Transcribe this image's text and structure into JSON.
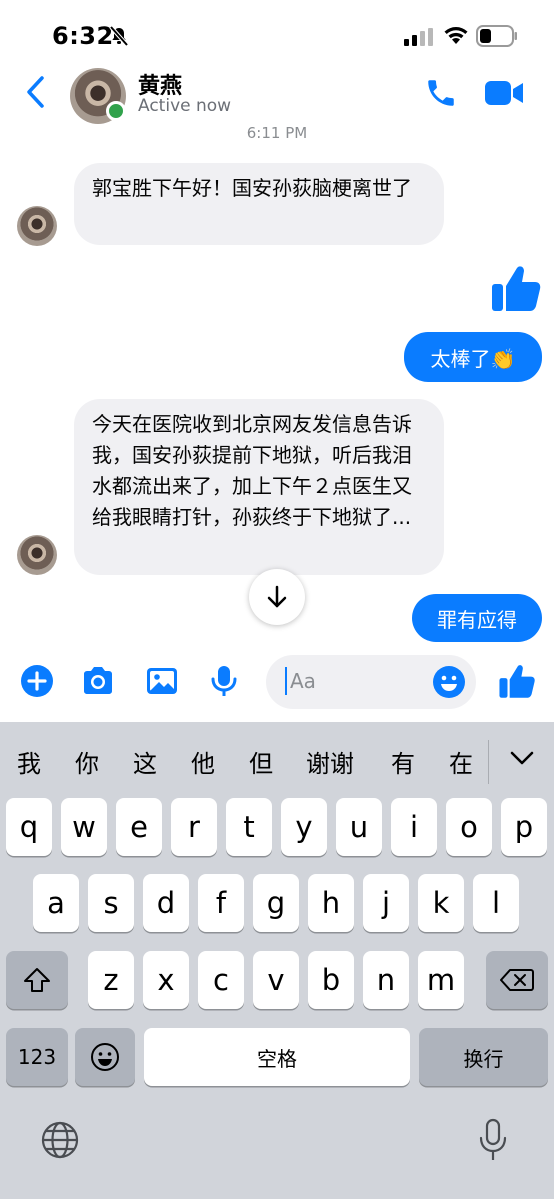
{
  "status_bar": {
    "time": "6:32"
  },
  "header": {
    "name": "黄燕",
    "status": "Active now"
  },
  "timestamp": "6:11 PM",
  "messages": [
    {
      "side": "in",
      "text": "郭宝胜下午好！国安孙荻脑梗离世了"
    },
    {
      "side": "out",
      "type": "like"
    },
    {
      "side": "out",
      "text": "太棒了👏"
    },
    {
      "side": "in",
      "text": "今天在医院收到北京网友发信息告诉我，国安孙荻提前下地狱，听后我泪水都流出来了，加上下午２点医生又给我眼睛打针，孙荻终于下地狱了..."
    },
    {
      "side": "out",
      "text": "罪有应得"
    }
  ],
  "composer": {
    "placeholder": "Aa"
  },
  "keyboard": {
    "suggestions": [
      "我",
      "你",
      "这",
      "他",
      "但",
      "谢谢",
      "有",
      "在"
    ],
    "row1": [
      "q",
      "w",
      "e",
      "r",
      "t",
      "y",
      "u",
      "i",
      "o",
      "p"
    ],
    "row2": [
      "a",
      "s",
      "d",
      "f",
      "g",
      "h",
      "j",
      "k",
      "l"
    ],
    "row3": [
      "z",
      "x",
      "c",
      "v",
      "b",
      "n",
      "m"
    ],
    "numbers_label": "123",
    "space_label": "空格",
    "return_label": "换行"
  },
  "colors": {
    "accent": "#0a7cff",
    "incoming_bubble": "#f0f0f3",
    "online": "#31a24c",
    "keyboard_bg": "#d1d4da"
  }
}
